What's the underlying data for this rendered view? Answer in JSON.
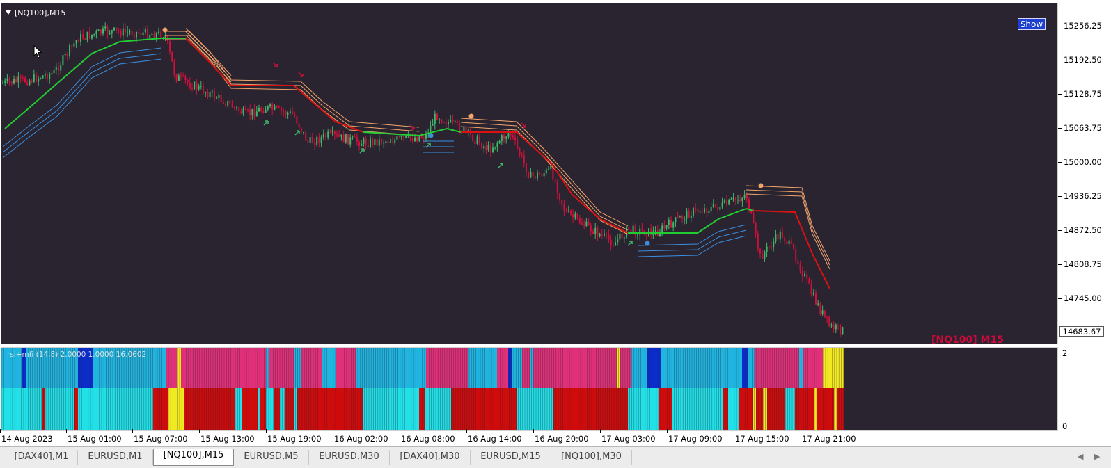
{
  "chart": {
    "symbol_label": "[NQ100],M15",
    "show_button": "Show",
    "watermark": "[NQ100] M15",
    "current_price": "14683.67",
    "price_ticks": [
      "15256.25",
      "15192.50",
      "15128.75",
      "15063.75",
      "15000.00",
      "14936.25",
      "14872.50",
      "14808.75",
      "14745.00"
    ],
    "time_ticks": [
      "14 Aug 2023",
      "15 Aug 01:00",
      "15 Aug 07:00",
      "15 Aug 13:00",
      "15 Aug 19:00",
      "16 Aug 02:00",
      "16 Aug 08:00",
      "16 Aug 14:00",
      "16 Aug 20:00",
      "17 Aug 03:00",
      "17 Aug 09:00",
      "17 Aug 15:00",
      "17 Aug 21:00"
    ],
    "indicator": {
      "label": "rsi+mfi (14,8) 2.0000 1.0000 16.0602",
      "scale_top": "2",
      "scale_bottom": "0"
    }
  },
  "tabs": [
    {
      "label": "[DAX40],M1",
      "active": false
    },
    {
      "label": "EURUSD,M1",
      "active": false
    },
    {
      "label": "[NQ100],M15",
      "active": true
    },
    {
      "label": "EURUSD,M5",
      "active": false
    },
    {
      "label": "EURUSD,M30",
      "active": false
    },
    {
      "label": "[DAX40],M30",
      "active": false
    },
    {
      "label": "EURUSD,M15",
      "active": false
    },
    {
      "label": "[NQ100],M30",
      "active": false
    }
  ],
  "colors": {
    "background": "#2a2430",
    "bull_candle": "#3fb86a",
    "bear_candle": "#d0103a",
    "trend_up": "#22cc33",
    "trend_down": "#dd1111",
    "upper_band": "#f2a46b",
    "lower_band": "#3a8fe0",
    "rsi_up": "#1fb5e0",
    "rsi_down": "#e0307a",
    "rsi_strong_up": "#0b2cc8",
    "mfi_up": "#22e0e8",
    "mfi_down": "#d00b0b",
    "neutral": "#f2ea20"
  },
  "icons": {
    "dropdown": "triangle-down-icon",
    "cursor": "mouse-pointer-icon",
    "scroll_left": "chevron-left-icon",
    "scroll_right": "chevron-right-icon"
  }
}
